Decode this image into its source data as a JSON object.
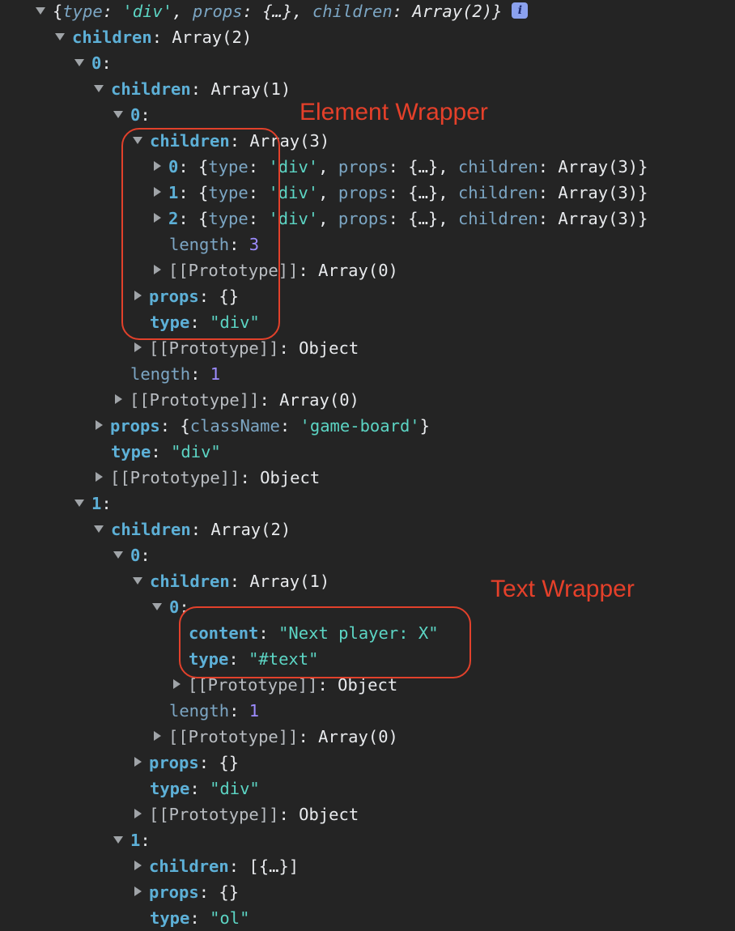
{
  "annotations": {
    "element_wrapper": "Element Wrapper",
    "text_wrapper": "Text Wrapper"
  },
  "colors": {
    "background": "#242424",
    "key": "#5db0d7",
    "string": "#5cd5c4",
    "number": "#9d8cff",
    "annotation": "#e2412b"
  },
  "tree": [
    {
      "toggle": "down",
      "parts": [
        [
          "p",
          "{"
        ],
        [
          "ki it",
          "type"
        ],
        [
          "p it",
          ": "
        ],
        [
          "s it",
          "'div'"
        ],
        [
          "p it",
          ", "
        ],
        [
          "ki it",
          "props"
        ],
        [
          "p it",
          ": {…}, "
        ],
        [
          "ki it",
          "children"
        ],
        [
          "p it",
          ": Array(2)}"
        ]
      ],
      "info": "i"
    },
    {
      "toggle": "down",
      "parts": [
        [
          "k",
          "children"
        ],
        [
          "p",
          ": Array(2)"
        ]
      ]
    },
    {
      "toggle": "down",
      "parts": [
        [
          "k",
          "0"
        ],
        [
          "p",
          ":"
        ]
      ]
    },
    {
      "toggle": "down",
      "parts": [
        [
          "k",
          "children"
        ],
        [
          "p",
          ": Array(1)"
        ]
      ]
    },
    {
      "toggle": "down",
      "parts": [
        [
          "k",
          "0"
        ],
        [
          "p",
          ":"
        ]
      ]
    },
    {
      "toggle": "down",
      "parts": [
        [
          "k",
          "children"
        ],
        [
          "p",
          ": Array(3)"
        ]
      ]
    },
    {
      "toggle": "right",
      "parts": [
        [
          "k",
          "0"
        ],
        [
          "p",
          ": {"
        ],
        [
          "ki",
          "type"
        ],
        [
          "p",
          ": "
        ],
        [
          "s",
          "'div'"
        ],
        [
          "p",
          ", "
        ],
        [
          "ki",
          "props"
        ],
        [
          "p",
          ": {…}, "
        ],
        [
          "ki",
          "children"
        ],
        [
          "p",
          ": Array(3)}"
        ]
      ]
    },
    {
      "toggle": "right",
      "parts": [
        [
          "k",
          "1"
        ],
        [
          "p",
          ": {"
        ],
        [
          "ki",
          "type"
        ],
        [
          "p",
          ": "
        ],
        [
          "s",
          "'div'"
        ],
        [
          "p",
          ", "
        ],
        [
          "ki",
          "props"
        ],
        [
          "p",
          ": {…}, "
        ],
        [
          "ki",
          "children"
        ],
        [
          "p",
          ": Array(3)}"
        ]
      ]
    },
    {
      "toggle": "right",
      "parts": [
        [
          "k",
          "2"
        ],
        [
          "p",
          ": {"
        ],
        [
          "ki",
          "type"
        ],
        [
          "p",
          ": "
        ],
        [
          "s",
          "'div'"
        ],
        [
          "p",
          ", "
        ],
        [
          "ki",
          "props"
        ],
        [
          "p",
          ": {…}, "
        ],
        [
          "ki",
          "children"
        ],
        [
          "p",
          ": Array(3)}"
        ]
      ]
    },
    {
      "toggle": "none",
      "parts": [
        [
          "ki",
          "length"
        ],
        [
          "p",
          ": "
        ],
        [
          "n",
          "3"
        ]
      ]
    },
    {
      "toggle": "right",
      "parts": [
        [
          "kg",
          "[[Prototype]]"
        ],
        [
          "p",
          ": Array(0)"
        ]
      ]
    },
    {
      "toggle": "right",
      "parts": [
        [
          "k",
          "props"
        ],
        [
          "p",
          ": {}"
        ]
      ]
    },
    {
      "toggle": "none",
      "parts": [
        [
          "k",
          "type"
        ],
        [
          "p",
          ": "
        ],
        [
          "s",
          "\"div\""
        ]
      ]
    },
    {
      "toggle": "right",
      "parts": [
        [
          "kg",
          "[[Prototype]]"
        ],
        [
          "p",
          ": Object"
        ]
      ]
    },
    {
      "toggle": "none",
      "parts": [
        [
          "ki",
          "length"
        ],
        [
          "p",
          ": "
        ],
        [
          "n",
          "1"
        ]
      ]
    },
    {
      "toggle": "right",
      "parts": [
        [
          "kg",
          "[[Prototype]]"
        ],
        [
          "p",
          ": Array(0)"
        ]
      ]
    },
    {
      "toggle": "right",
      "parts": [
        [
          "k",
          "props"
        ],
        [
          "p",
          ": {"
        ],
        [
          "ki",
          "className"
        ],
        [
          "p",
          ": "
        ],
        [
          "s",
          "'game-board'"
        ],
        [
          "p",
          "}"
        ]
      ]
    },
    {
      "toggle": "none",
      "parts": [
        [
          "k",
          "type"
        ],
        [
          "p",
          ": "
        ],
        [
          "s",
          "\"div\""
        ]
      ]
    },
    {
      "toggle": "right",
      "parts": [
        [
          "kg",
          "[[Prototype]]"
        ],
        [
          "p",
          ": Object"
        ]
      ]
    },
    {
      "toggle": "down",
      "parts": [
        [
          "k",
          "1"
        ],
        [
          "p",
          ":"
        ]
      ]
    },
    {
      "toggle": "down",
      "parts": [
        [
          "k",
          "children"
        ],
        [
          "p",
          ": Array(2)"
        ]
      ]
    },
    {
      "toggle": "down",
      "parts": [
        [
          "k",
          "0"
        ],
        [
          "p",
          ":"
        ]
      ]
    },
    {
      "toggle": "down",
      "parts": [
        [
          "k",
          "children"
        ],
        [
          "p",
          ": Array(1)"
        ]
      ]
    },
    {
      "toggle": "down",
      "parts": [
        [
          "k",
          "0"
        ],
        [
          "p",
          ":"
        ]
      ]
    },
    {
      "toggle": "none",
      "parts": [
        [
          "k",
          "content"
        ],
        [
          "p",
          ": "
        ],
        [
          "s",
          "\"Next player: X\""
        ]
      ]
    },
    {
      "toggle": "none",
      "parts": [
        [
          "k",
          "type"
        ],
        [
          "p",
          ": "
        ],
        [
          "s",
          "\"#text\""
        ]
      ]
    },
    {
      "toggle": "right",
      "parts": [
        [
          "kg",
          "[[Prototype]]"
        ],
        [
          "p",
          ": Object"
        ]
      ]
    },
    {
      "toggle": "none",
      "parts": [
        [
          "ki",
          "length"
        ],
        [
          "p",
          ": "
        ],
        [
          "n",
          "1"
        ]
      ]
    },
    {
      "toggle": "right",
      "parts": [
        [
          "kg",
          "[[Prototype]]"
        ],
        [
          "p",
          ": Array(0)"
        ]
      ]
    },
    {
      "toggle": "right",
      "parts": [
        [
          "k",
          "props"
        ],
        [
          "p",
          ": {}"
        ]
      ]
    },
    {
      "toggle": "none",
      "parts": [
        [
          "k",
          "type"
        ],
        [
          "p",
          ": "
        ],
        [
          "s",
          "\"div\""
        ]
      ]
    },
    {
      "toggle": "right",
      "parts": [
        [
          "kg",
          "[[Prototype]]"
        ],
        [
          "p",
          ": Object"
        ]
      ]
    },
    {
      "toggle": "down",
      "parts": [
        [
          "k",
          "1"
        ],
        [
          "p",
          ":"
        ]
      ]
    },
    {
      "toggle": "right",
      "parts": [
        [
          "k",
          "children"
        ],
        [
          "p",
          ": [{…}]"
        ]
      ]
    },
    {
      "toggle": "right",
      "parts": [
        [
          "k",
          "props"
        ],
        [
          "p",
          ": {}"
        ]
      ]
    },
    {
      "toggle": "none",
      "parts": [
        [
          "k",
          "type"
        ],
        [
          "p",
          ": "
        ],
        [
          "s",
          "\"ol\""
        ]
      ]
    }
  ]
}
